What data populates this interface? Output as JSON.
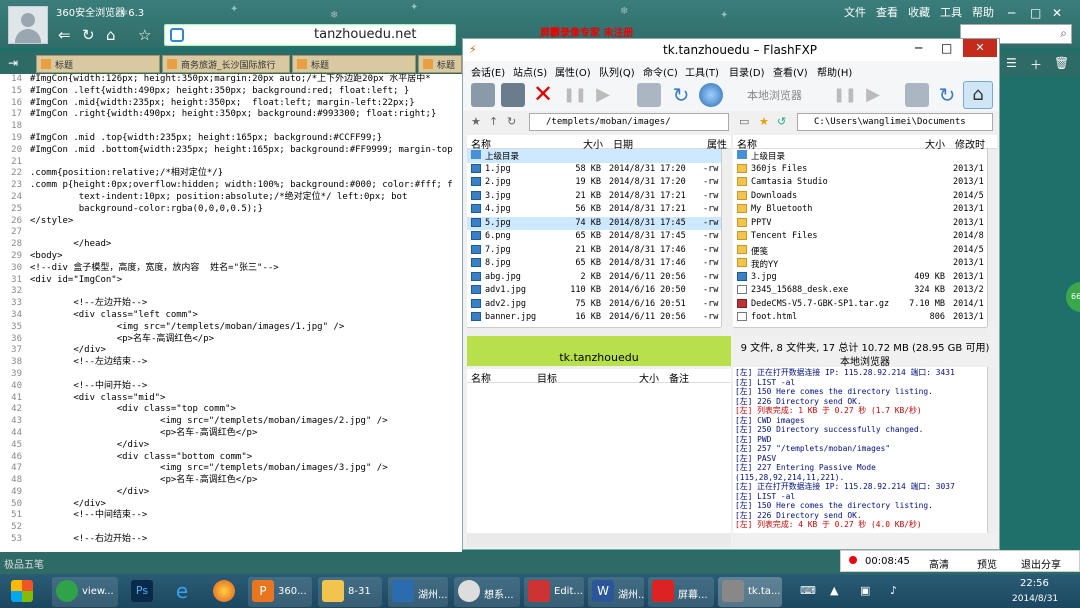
{
  "browser": {
    "title": "360安全浏览器 6.3",
    "address": "tanzhouedu.net",
    "ad_text": "屏霸录像专家 未注册",
    "menu": [
      "文件",
      "查看",
      "收藏",
      "工具",
      "帮助"
    ],
    "tabs": [
      "标题",
      "商务旅游_长沙国际旅行",
      "标题",
      "标题"
    ]
  },
  "editor": {
    "lines": [
      {
        "n": "14",
        "t": "#ImgCon{width:126px; height:350px;margin:20px auto;/*上下外边距20px 水平居中*"
      },
      {
        "n": "15",
        "t": "#ImgCon .left{width:490px; height:350px; background:red; float:left; }"
      },
      {
        "n": "16",
        "t": "#ImgCon .mid{width:235px; height:350px;  float:left; margin-left:22px;}"
      },
      {
        "n": "17",
        "t": "#ImgCon .right{width:490px; height:350px; background:#993300; float:right;}"
      },
      {
        "n": "18",
        "t": ""
      },
      {
        "n": "19",
        "t": "#ImgCon .mid .top{width:235px; height:165px; background:#CCFF99;}"
      },
      {
        "n": "20",
        "t": "#ImgCon .mid .bottom{width:235px; height:165px; background:#FF9999; margin-top"
      },
      {
        "n": "21",
        "t": ""
      },
      {
        "n": "22",
        "t": ".comm{position:relative;/*相对定位*/}"
      },
      {
        "n": "23",
        "t": ".comm p{height:0px;overflow:hidden; width:100%; background:#000; color:#fff; f"
      },
      {
        "n": "24",
        "t": "         text-indent:10px; position:absolute;/*绝对定位*/ left:0px; bot"
      },
      {
        "n": "25",
        "t": "         background-color:rgba(0,0,0,0.5);}"
      },
      {
        "n": "26",
        "t": "</style>"
      },
      {
        "n": "27",
        "t": ""
      },
      {
        "n": "28",
        "t": "        </head>"
      },
      {
        "n": "29",
        "t": "<body>"
      },
      {
        "n": "30",
        "t": "<!--div 盒子模型，高度，宽度，放内容  姓名=\"张三\"-->"
      },
      {
        "n": "31",
        "t": "<div id=\"ImgCon\">"
      },
      {
        "n": "32",
        "t": ""
      },
      {
        "n": "33",
        "t": "        <!--左边开始-->"
      },
      {
        "n": "34",
        "t": "        <div class=\"left comm\">"
      },
      {
        "n": "35",
        "t": "                <img src=\"/templets/moban/images/1.jpg\" />"
      },
      {
        "n": "36",
        "t": "                <p>名车-高调红色</p>"
      },
      {
        "n": "37",
        "t": "        </div>"
      },
      {
        "n": "38",
        "t": "        <!--左边结束-->"
      },
      {
        "n": "39",
        "t": ""
      },
      {
        "n": "40",
        "t": "        <!--中间开始-->"
      },
      {
        "n": "41",
        "t": "        <div class=\"mid\">"
      },
      {
        "n": "42",
        "t": "                <div class=\"top comm\">"
      },
      {
        "n": "43",
        "t": "                        <img src=\"/templets/moban/images/2.jpg\" />"
      },
      {
        "n": "44",
        "t": "                        <p>名车-高调红色</p>"
      },
      {
        "n": "45",
        "t": "                </div>"
      },
      {
        "n": "46",
        "t": "                <div class=\"bottom comm\">"
      },
      {
        "n": "47",
        "t": "                        <img src=\"/templets/moban/images/3.jpg\" />"
      },
      {
        "n": "48",
        "t": "                        <p>名车-高调红色</p>"
      },
      {
        "n": "49",
        "t": "                </div>"
      },
      {
        "n": "50",
        "t": "        </div>"
      },
      {
        "n": "51",
        "t": "        <!--中间结束-->"
      },
      {
        "n": "52",
        "t": ""
      },
      {
        "n": "53",
        "t": "        <!--右边开始-->"
      }
    ]
  },
  "fxp": {
    "title": "tk.tanzhouedu – FlashFXP",
    "menu": [
      "会话(E)",
      "站点(S)",
      "属性(O)",
      "队列(Q)",
      "命令(C)",
      "工具(T)",
      "目录(D)",
      "查看(V)",
      "帮助(H)"
    ],
    "local_browser_btn": "本地浏览器",
    "remote_path": "/templets/moban/images/",
    "local_path": "C:\\Users\\wanglimei\\Documents",
    "remote_headers": [
      "名称",
      "大小",
      "日期",
      "属性"
    ],
    "local_headers": [
      "名称",
      "大小",
      "修改时"
    ],
    "remote_files": [
      {
        "name": "上级目录",
        "size": "",
        "date": "",
        "attr": "",
        "icon": "up"
      },
      {
        "name": "1.jpg",
        "size": "58 KB",
        "date": "2014/8/31 17:20",
        "attr": "-rw",
        "icon": "img"
      },
      {
        "name": "2.jpg",
        "size": "19 KB",
        "date": "2014/8/31 17:20",
        "attr": "-rw",
        "icon": "img"
      },
      {
        "name": "3.jpg",
        "size": "21 KB",
        "date": "2014/8/31 17:21",
        "attr": "-rw",
        "icon": "img"
      },
      {
        "name": "4.jpg",
        "size": "56 KB",
        "date": "2014/8/31 17:21",
        "attr": "-rw",
        "icon": "img"
      },
      {
        "name": "5.jpg",
        "size": "74 KB",
        "date": "2014/8/31 17:45",
        "attr": "-rw",
        "icon": "img"
      },
      {
        "name": "6.png",
        "size": "65 KB",
        "date": "2014/8/31 17:45",
        "attr": "-rw",
        "icon": "img"
      },
      {
        "name": "7.jpg",
        "size": "21 KB",
        "date": "2014/8/31 17:46",
        "attr": "-rw",
        "icon": "img"
      },
      {
        "name": "8.jpg",
        "size": "65 KB",
        "date": "2014/8/31 17:46",
        "attr": "-rw",
        "icon": "img"
      },
      {
        "name": "abg.jpg",
        "size": "2 KB",
        "date": "2014/6/11 20:56",
        "attr": "-rw",
        "icon": "img"
      },
      {
        "name": "adv1.jpg",
        "size": "110 KB",
        "date": "2014/6/16 20:50",
        "attr": "-rw",
        "icon": "img"
      },
      {
        "name": "adv2.jpg",
        "size": "75 KB",
        "date": "2014/6/16 20:51",
        "attr": "-rw",
        "icon": "img"
      },
      {
        "name": "banner.jpg",
        "size": "16 KB",
        "date": "2014/6/11 20:56",
        "attr": "-rw",
        "icon": "img"
      }
    ],
    "local_files": [
      {
        "name": "上级目录",
        "size": "",
        "date": "",
        "icon": "up"
      },
      {
        "name": "360js Files",
        "size": "",
        "date": "2013/1",
        "icon": "dir"
      },
      {
        "name": "Camtasia Studio",
        "size": "",
        "date": "2013/1",
        "icon": "dir"
      },
      {
        "name": "Downloads",
        "size": "",
        "date": "2014/5",
        "icon": "dir"
      },
      {
        "name": "My Bluetooth",
        "size": "",
        "date": "2013/1",
        "icon": "dir"
      },
      {
        "name": "PPTV",
        "size": "",
        "date": "2013/1",
        "icon": "dir"
      },
      {
        "name": "Tencent Files",
        "size": "",
        "date": "2014/8",
        "icon": "dir"
      },
      {
        "name": "便笺",
        "size": "",
        "date": "2014/5",
        "icon": "dir"
      },
      {
        "name": "我的YY",
        "size": "",
        "date": "2013/1",
        "icon": "dir"
      },
      {
        "name": "3.jpg",
        "size": "409 KB",
        "date": "2013/1",
        "icon": "img"
      },
      {
        "name": "2345_15688_desk.exe",
        "size": "324 KB",
        "date": "2013/2",
        "icon": "file"
      },
      {
        "name": "DedeCMS-V5.7-GBK-SP1.tar.gz",
        "size": "7.10 MB",
        "date": "2014/1",
        "icon": "arc"
      },
      {
        "name": "foot.html",
        "size": "806",
        "date": "2013/1",
        "icon": "file"
      }
    ],
    "site_name": "tk.tanzhouedu",
    "local_info": "9 文件, 8 文件夹, 17 总计 10.72 MB (28.95 GB 可用)",
    "local_label": "本地浏览器",
    "queue_headers": [
      "名称",
      "目标",
      "大小",
      "备注"
    ],
    "log": [
      {
        "t": "[左] 正在打开数据连接 IP: 115.28.92.214 端口: 3431",
        "c": "blue"
      },
      {
        "t": "[左] LIST -al",
        "c": "blue"
      },
      {
        "t": "[左] 150 Here comes the directory listing.",
        "c": "blue"
      },
      {
        "t": "[左] 226 Directory send OK.",
        "c": "blue"
      },
      {
        "t": "[左] 列表完成: 1 KB 于 0.27 秒 (1.7 KB/秒)",
        "c": "red"
      },
      {
        "t": "[左] CWD images",
        "c": "blue"
      },
      {
        "t": "[左] 250 Directory successfully changed.",
        "c": "blue"
      },
      {
        "t": "[左] PWD",
        "c": "blue"
      },
      {
        "t": "[左] 257 \"/templets/moban/images\"",
        "c": "blue"
      },
      {
        "t": "[左] PASV",
        "c": "blue"
      },
      {
        "t": "[左] 227 Entering Passive Mode",
        "c": "blue"
      },
      {
        "t": "(115,28,92,214,11,221).",
        "c": "blue"
      },
      {
        "t": "[左] 正在打开数据连接 IP: 115.28.92.214 端口: 3037",
        "c": "blue"
      },
      {
        "t": "[左] LIST -al",
        "c": "blue"
      },
      {
        "t": "[左] 150 Here comes the directory listing.",
        "c": "blue"
      },
      {
        "t": "[左] 226 Directory send OK.",
        "c": "blue"
      },
      {
        "t": "[左] 列表完成: 4 KB 于 0.27 秒 (4.0 KB/秒)",
        "c": "red"
      }
    ]
  },
  "recorder": {
    "time": "00:08:45",
    "quality": "高清",
    "preview": "预览",
    "exit": "退出分享"
  },
  "bottom_text": "极品五笔",
  "taskbar": {
    "items": [
      "view...",
      "",
      "",
      "",
      "360...",
      "8-31",
      "湖州...",
      "想系...",
      "Edit...",
      "湖州...",
      "屏幕...",
      "tk.ta..."
    ],
    "time": "22:56",
    "date": "2014/8/31"
  },
  "side_badge": "66"
}
